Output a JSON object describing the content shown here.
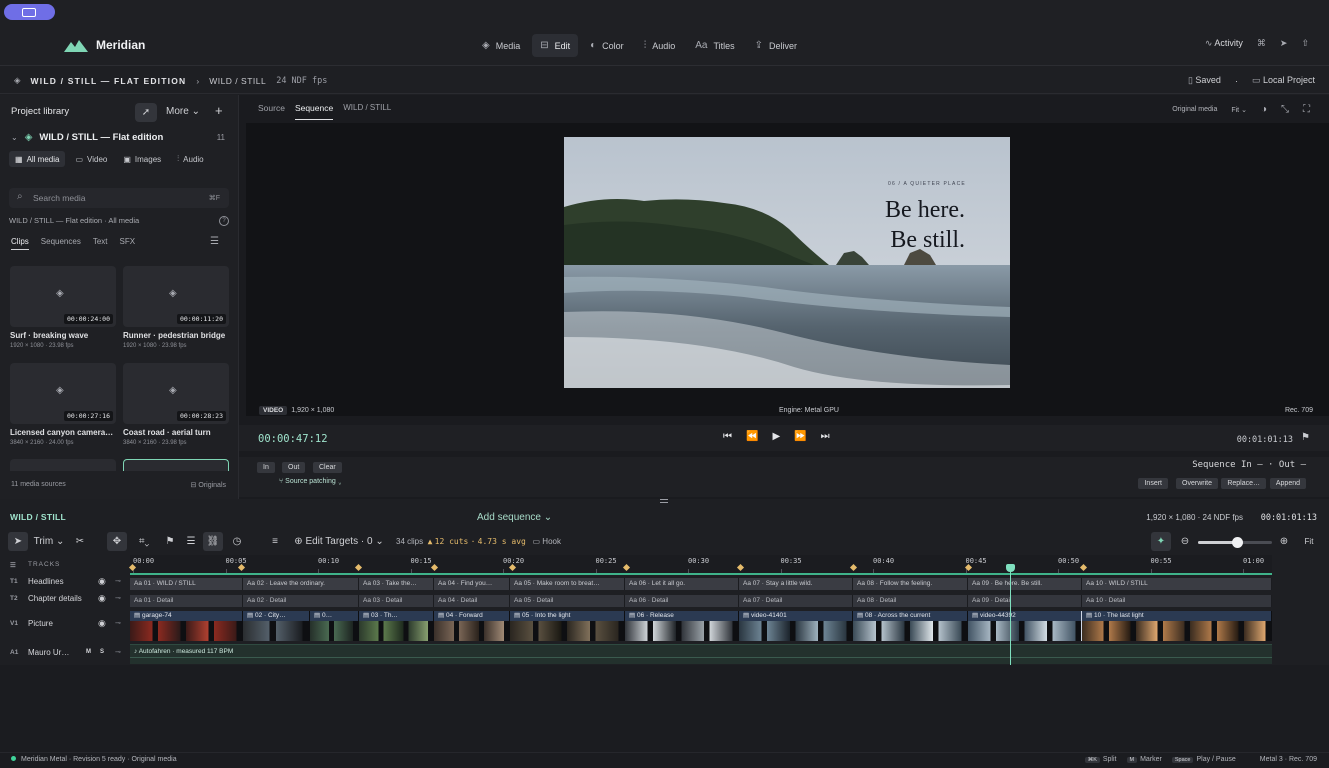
{
  "app": {
    "name": "Meridian"
  },
  "nav": [
    {
      "label": "Media",
      "icon": "stack-icon"
    },
    {
      "label": "Edit",
      "icon": "film-icon",
      "active": true
    },
    {
      "label": "Color",
      "icon": "color-wheel-icon"
    },
    {
      "label": "Audio",
      "icon": "waveform-icon"
    },
    {
      "label": "Titles",
      "icon": "text-icon"
    },
    {
      "label": "Deliver",
      "icon": "export-icon"
    }
  ],
  "topright": {
    "activity": "Activity"
  },
  "breadcrumb": {
    "project": "WILD / STILL — FLAT EDITION",
    "sequence": "WILD / STILL",
    "fps": "24 NDF fps"
  },
  "save": {
    "status": "Saved",
    "location": "Local Project"
  },
  "library": {
    "title": "Project library",
    "more": "More",
    "project_name": "WILD / STILL — Flat edition",
    "count": "11",
    "media_tabs": [
      "All media",
      "Video",
      "Images",
      "Audio"
    ],
    "search_placeholder": "Search media",
    "search_shortcut": "⌘F",
    "scope": "WILD / STILL — Flat edition · All media",
    "clip_tabs": [
      "Clips",
      "Sequences",
      "Text",
      "SFX"
    ],
    "clips": [
      {
        "name": "Surf · breaking wave",
        "meta": "1920 × 1080 · 23.98 fps",
        "dur": "00:00:24:00"
      },
      {
        "name": "Runner · pedestrian bridge",
        "meta": "1920 × 1080 · 23.98 fps",
        "dur": "00:00:11:20"
      },
      {
        "name": "Licensed canyon camera…",
        "meta": "3840 × 2160 · 24.00 fps",
        "dur": "00:00:27:16"
      },
      {
        "name": "Coast road · aerial turn",
        "meta": "3840 × 2160 · 23.98 fps",
        "dur": "00:00:28:23"
      }
    ],
    "footer": "11 media sources",
    "footer_right": "Originals"
  },
  "viewer": {
    "tabs": [
      "Source",
      "Sequence",
      "WILD / STILL"
    ],
    "quality": "Original media",
    "zoom": "Fit",
    "frame_kicker": "06  /  A QUIETER PLACE",
    "frame_line1": "Be here.",
    "frame_line2": "Be still.",
    "video_tag": "VIDEO",
    "resolution": "1,920 × 1,080",
    "engine": "Engine: Metal GPU",
    "colorspace": "Rec. 709",
    "timecode": "00:00:47:12",
    "duration": "00:01:01:13",
    "in": "In",
    "out": "Out",
    "clear": "Clear",
    "patching": "Source patching",
    "seq_io": "Sequence In –  · Out –",
    "actions": [
      "Insert",
      "Overwrite",
      "Replace…",
      "Append"
    ]
  },
  "timeline": {
    "name": "WILD / STILL",
    "add_sequence": "Add sequence",
    "format": "1,920 × 1,080 · 24 NDF fps",
    "duration": "00:01:01:13",
    "trim": "Trim",
    "edit_targets": "Edit Targets · 0",
    "clips_count": "34 clips",
    "cuts": "12 cuts",
    "avg": "4.73 s avg",
    "hook": "Hook",
    "fit": "Fit",
    "tracks_label": "TRACKS",
    "ruler": [
      "00:00",
      "00:05",
      "00:10",
      "00:15",
      "00:20",
      "00:25",
      "00:30",
      "00:35",
      "00:40",
      "00:45",
      "00:50",
      "00:55",
      "01:00"
    ],
    "tracks": [
      {
        "id": "T1",
        "name": "Headlines"
      },
      {
        "id": "T2",
        "name": "Chapter details"
      },
      {
        "id": "V1",
        "name": "Picture"
      },
      {
        "id": "A1",
        "name": "Mauro Ur…",
        "m": "M",
        "s": "S"
      }
    ],
    "headlines": [
      "Aa 01 · WILD / STILL",
      "Aa 02 · Leave the ordinary.",
      "Aa 03 · Take the…",
      "Aa 04 · Find you…",
      "Aa 05 · Make room to breat…",
      "Aa 06 · Let it all go.",
      "Aa 07 · Stay a little wild.",
      "Aa 08 · Follow the feeling.",
      "Aa 09 · Be here. Be still.",
      "Aa 10 · WILD / STILL"
    ],
    "details": [
      "Aa 01 · Detail",
      "Aa 02 · Detail",
      "Aa 03 · Detail",
      "Aa 04 · Detail",
      "Aa 05 · Detail",
      "Aa 06 · Detail",
      "Aa 07 · Detail",
      "Aa 08 · Detail",
      "Aa 09 · Detail",
      "Aa 10 · Detail"
    ],
    "picture": [
      "garage-74",
      "02 · City…",
      "0…",
      "03 · Th…",
      "04 · Forward",
      "05 · Into the light",
      "06 · Release",
      "video-41401",
      "08 · Across the current",
      "video-44392",
      "10 · The last light"
    ],
    "audio": "♪ Autofahren · measured 117 BPM"
  },
  "status": {
    "left": "Meridian Metal · Revision 5 ready · Original media",
    "split": "Split",
    "marker": "Marker",
    "play": "Play / Pause",
    "engine": "Metal 3 · Rec. 709"
  }
}
